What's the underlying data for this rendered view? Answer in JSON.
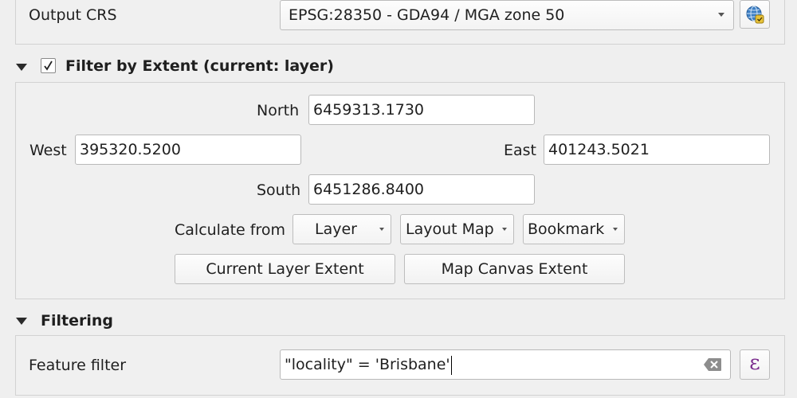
{
  "output_crs": {
    "label": "Output CRS",
    "value": "EPSG:28350 - GDA94 / MGA zone 50"
  },
  "extent": {
    "title": "Filter by Extent (current: layer)",
    "checked": true,
    "north_label": "North",
    "north_value": "6459313.1730",
    "west_label": "West",
    "west_value": "395320.5200",
    "east_label": "East",
    "east_value": "401243.5021",
    "south_label": "South",
    "south_value": "6451286.8400",
    "calc_label": "Calculate from",
    "layer_btn": "Layer",
    "layout_map_btn": "Layout Map",
    "bookmark_btn": "Bookmark",
    "current_layer_extent_btn": "Current Layer Extent",
    "map_canvas_extent_btn": "Map Canvas Extent"
  },
  "filtering": {
    "title": "Filtering",
    "feature_filter_label": "Feature filter",
    "feature_filter_value": "\"locality\" = 'Brisbane'"
  },
  "icons": {
    "crs_selector": "globe-icon",
    "clear": "backspace-clear-icon",
    "expression": "epsilon-expression-icon",
    "collapse": "triangle-down-icon",
    "check": "checkmark-icon"
  },
  "colors": {
    "background": "#efefef",
    "group_border": "#d2d2d2",
    "expression_purple": "#7b2d8e"
  }
}
